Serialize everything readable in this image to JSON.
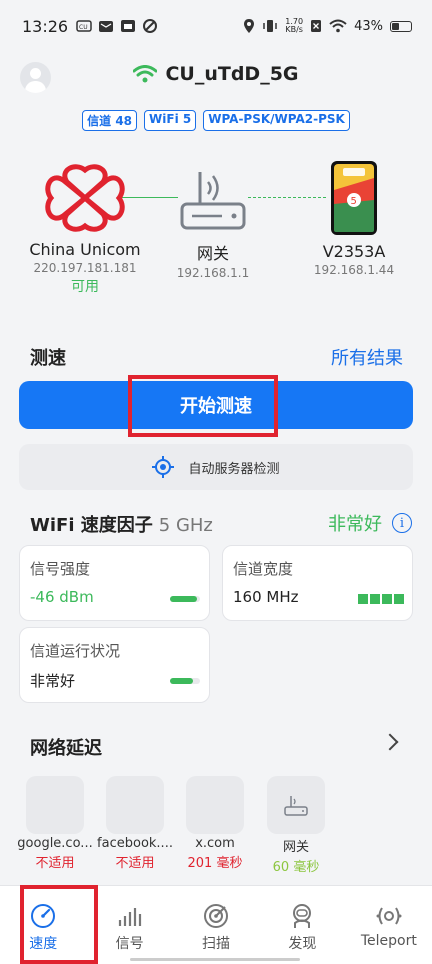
{
  "status_bar": {
    "time": "13:26",
    "net_speed_value": "1.70",
    "net_speed_unit": "KB/s",
    "battery": "43%"
  },
  "header": {
    "ssid": "CU_uTdD_5G",
    "badges": [
      "信道 48",
      "WiFi 5",
      "WPA-PSK/WPA2-PSK"
    ]
  },
  "topology": {
    "isp": {
      "name": "China Unicom",
      "ip": "220.197.181.181",
      "status": "可用"
    },
    "gateway": {
      "name": "网关",
      "ip": "192.168.1.1"
    },
    "device": {
      "name": "V2353A",
      "ip": "192.168.1.44"
    }
  },
  "speed_test": {
    "title": "测速",
    "all_results": "所有结果",
    "start_button": "开始测速",
    "auto_server": "自动服务器检测"
  },
  "wifi_factor": {
    "title": "WiFi 速度因子",
    "band": "5 GHz",
    "rating": "非常好",
    "info": "i",
    "cards": {
      "signal": {
        "label": "信号强度",
        "value": "-46 dBm",
        "level": 0.9
      },
      "bandwidth": {
        "label": "信道宽度",
        "value": "160 MHz",
        "bars": 4
      },
      "channel": {
        "label": "信道运行状况",
        "value": "非常好",
        "level": 0.75
      }
    }
  },
  "latency": {
    "title": "网络延迟",
    "sites": [
      {
        "name": "google.co...",
        "result": "不适用"
      },
      {
        "name": "facebook....",
        "result": "不适用"
      },
      {
        "name": "x.com",
        "result": "201 毫秒"
      },
      {
        "name": "网关",
        "result": "60 毫秒"
      }
    ]
  },
  "nav": {
    "items": [
      "速度",
      "信号",
      "扫描",
      "发现",
      "Teleport"
    ],
    "active": 0
  },
  "colors": {
    "accent": "#1677f5",
    "good": "#3cb95b",
    "bad": "#e0232f",
    "highlight_box": "#e0232f"
  }
}
